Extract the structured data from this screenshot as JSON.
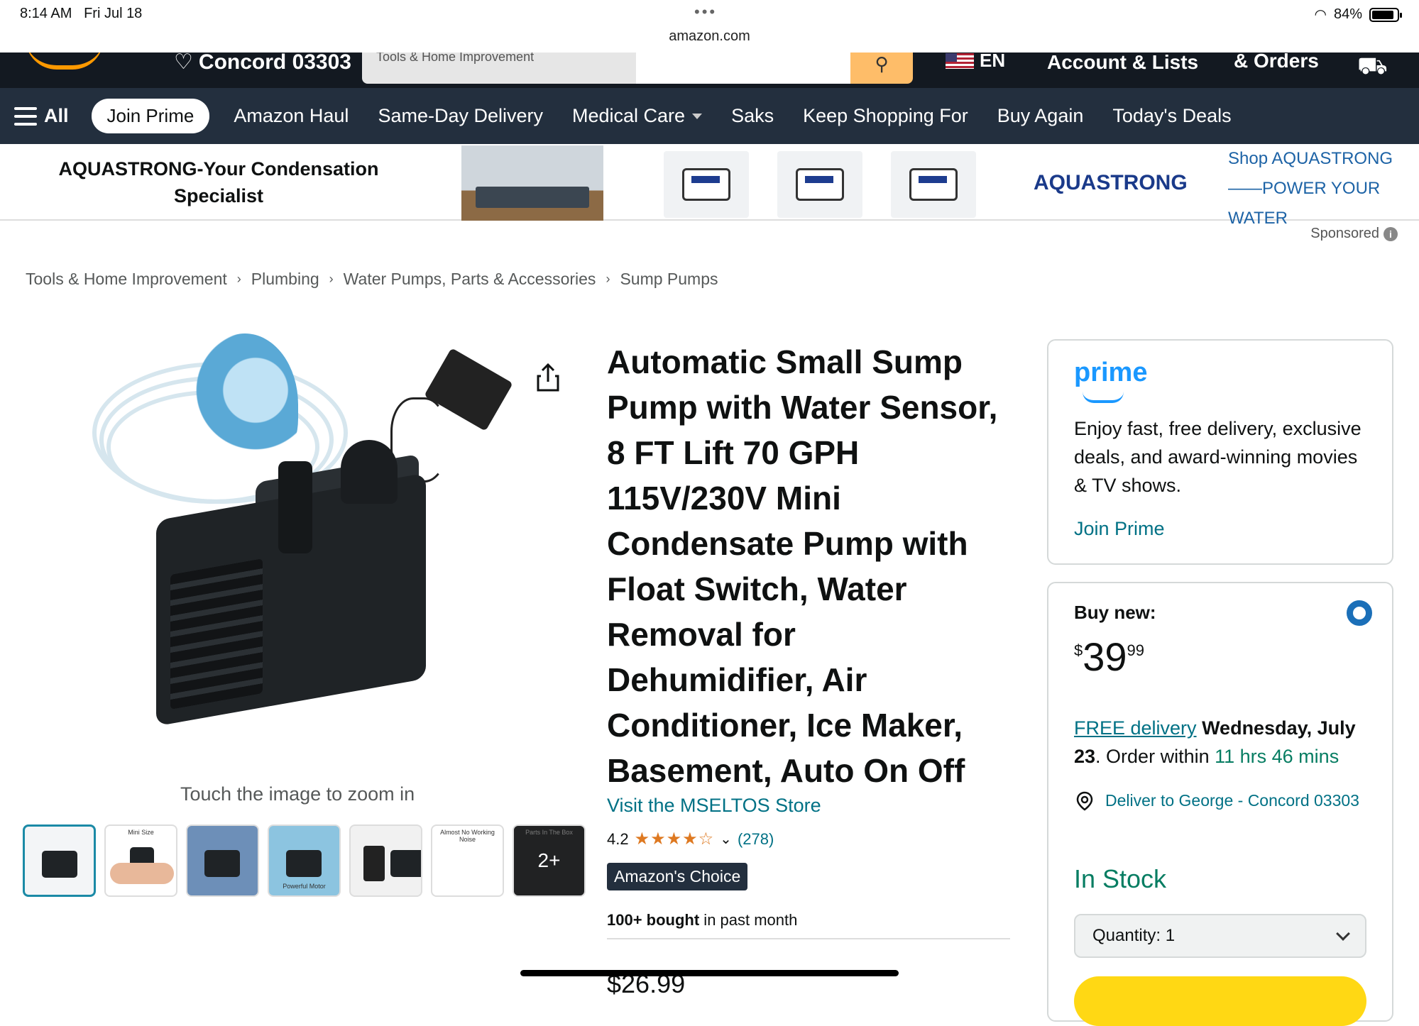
{
  "status_bar": {
    "time": "8:14 AM",
    "date": "Fri Jul 18",
    "url": "amazon.com",
    "battery": "84%"
  },
  "header": {
    "deliver_location": "Concord 03303",
    "search_category": "Tools & Home Improvement",
    "language": "EN",
    "account": "Account & Lists",
    "orders": "& Orders"
  },
  "nav": {
    "all_label": "All",
    "join_prime": "Join Prime",
    "items": [
      "Amazon Haul",
      "Same-Day Delivery",
      "Medical Care",
      "Saks",
      "Keep Shopping For",
      "Buy Again",
      "Today's Deals"
    ]
  },
  "banner": {
    "headline": "AQUASTRONG-Your Condensation Specialist",
    "brand": "AQUASTRONG",
    "cta": "Shop AQUASTRONG ——POWER YOUR WATER",
    "sponsored": "Sponsored"
  },
  "breadcrumb": [
    "Tools & Home Improvement",
    "Plumbing",
    "Water Pumps, Parts & Accessories",
    "Sump Pumps"
  ],
  "gallery": {
    "zoom_hint": "Touch the image to zoom in",
    "thumbnails": [
      {
        "caption": ""
      },
      {
        "caption": "Mini Size"
      },
      {
        "caption": ""
      },
      {
        "caption": "Powerful Motor"
      },
      {
        "caption": ""
      },
      {
        "caption": "Almost No Working Noise"
      },
      {
        "caption": "Parts In The Box"
      }
    ],
    "more_count": "2+"
  },
  "product": {
    "title": "Automatic Small Sump Pump with Water Sensor, 8 FT Lift 70 GPH 115V/230V Mini Condensate Pump with Float Switch, Water Removal for Dehumidifier, Air Conditioner, Ice Maker, Basement, Auto On Off",
    "store": "Visit the MSELTOS Store",
    "rating": "4.2",
    "stars": "★★★★☆",
    "rating_count": "(278)",
    "badge": "Amazon's Choice",
    "bought_bold": "100+ bought",
    "bought_rest": " in past month",
    "partial_price": "$26.99"
  },
  "prime_card": {
    "logo": "prime",
    "description": "Enjoy fast, free delivery, exclusive deals, and award-winning movies & TV shows.",
    "join": "Join Prime"
  },
  "buy_box": {
    "label": "Buy new:",
    "price_symbol": "$",
    "price_whole": "39",
    "price_fraction": "99",
    "free_delivery": "FREE delivery",
    "delivery_date": "Wednesday, July 23",
    "order_within_prefix": ". Order within ",
    "order_within_time": "11 hrs 46 mins",
    "deliver_to": "Deliver to George - Concord 03303",
    "stock": "In Stock",
    "quantity": "Quantity:  1"
  },
  "colors": {
    "accent_link": "#007185",
    "nav_bg": "#232f3e",
    "header_bg": "#131921",
    "prime_blue": "#1a98ff",
    "stock_green": "#067d62"
  }
}
